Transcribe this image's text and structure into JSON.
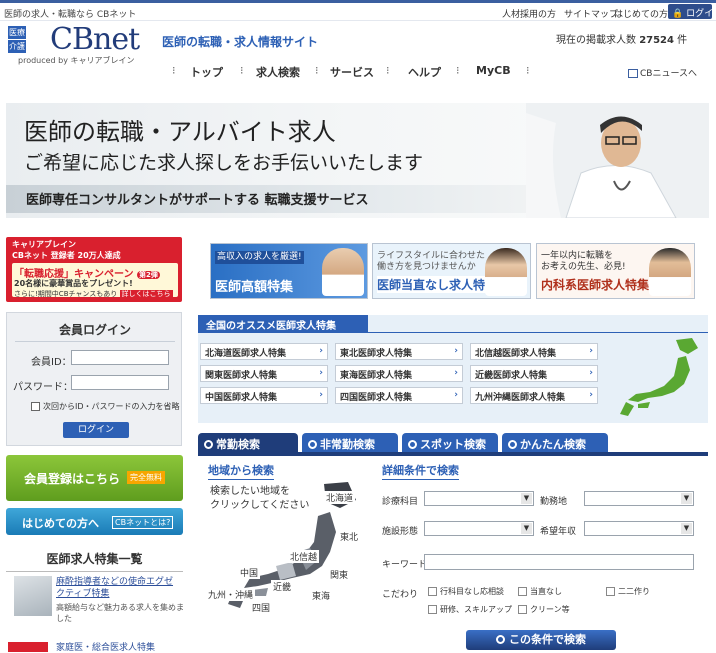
{
  "header": {
    "tagline": "医師の求人・転職なら CBネット",
    "top_links": [
      "人材採用の方",
      "サイトマップ",
      "はじめての方"
    ],
    "login_label": "ログイン",
    "logo_box_1": "医療",
    "logo_box_2": "介護",
    "logo_text": "CBnet",
    "logo_sub": "produced by キャリアブレイン",
    "site_subtitle": "医師の転職・求人情報サイト",
    "job_count_label": "現在の掲載求人数",
    "job_count_value": "27524",
    "job_count_unit": "件",
    "cbnews_label": "CBニュースへ"
  },
  "nav": {
    "items": [
      "トップ",
      "求人検索",
      "サービス",
      "ヘルプ",
      "MyCB"
    ]
  },
  "hero": {
    "line1": "医師の転職・アルバイト求人",
    "line2": "ご希望に応じた求人探しをお手伝いいたします",
    "line3": "医師専任コンサルタントがサポートする 転職支援サービス"
  },
  "promo": {
    "line1": "キャリアブレイン",
    "line2": "CBネット 登録者 20万人達成",
    "line3": "「転職応援」キャンペーン",
    "badge": "第2弾",
    "line4": "20名様に豪華賞品をプレゼント!",
    "line5": "さらに!期間中CBチャンスもあり",
    "link": "詳しくはこちら"
  },
  "login": {
    "title": "会員ログイン",
    "id_label": "会員ID：",
    "pw_label": "パスワード：",
    "remember_label": "次回からID・パスワードの入力を省略",
    "button": "ログイン"
  },
  "register": {
    "label": "会員登録はこちら",
    "badge": "完全無料"
  },
  "first_time": {
    "label": "はじめての方へ",
    "badge": "CBネットとは?"
  },
  "features": {
    "title": "医師求人特集一覧",
    "item1_link_l1": "麻酔指導者などの使命エグゼ",
    "item1_link_l2": "クティブ特集",
    "item1_desc_l1": "高額給与など魅力ある求人を集めま",
    "item1_desc_l2": "した",
    "item2_link": "家庭医・総合医求人特集"
  },
  "banners": [
    {
      "top": "高収入の求人を厳選!",
      "top2": "医師高額特集",
      "main": "医師高額特集"
    },
    {
      "top": "ライフスタイルに合わせた",
      "top2": "働き方を見つけませんか",
      "main": "医師当直なし求人特集"
    },
    {
      "top": "一年以内に転職を",
      "top2": "お考えの先生、必見!",
      "main": "内科系医師求人特集"
    }
  ],
  "osusume": {
    "title": "全国のオススメ医師求人特集",
    "rows": [
      [
        "北海道医師求人特集",
        "東北医師求人特集",
        "北信越医師求人特集"
      ],
      [
        "関東医師求人特集",
        "東海医師求人特集",
        "近畿医師求人特集"
      ],
      [
        "中国医師求人特集",
        "四国医師求人特集",
        "九州沖縄医師求人特集"
      ]
    ]
  },
  "search_tabs": [
    "常勤検索",
    "非常勤検索",
    "スポット検索",
    "かんたん検索"
  ],
  "area_search": {
    "title": "地域から検索",
    "desc_l1": "検索したい地域を",
    "desc_l2": "クリックしてください",
    "regions": [
      "北海道",
      "東北",
      "北信越",
      "関東",
      "東海",
      "近畿",
      "中国",
      "四国",
      "九州・沖縄"
    ]
  },
  "detail_search": {
    "title": "詳細条件で検索",
    "field_subject": "診療科目",
    "field_location": "勤務地",
    "field_facility": "施設形態",
    "field_salary": "希望年収",
    "field_keyword": "キーワード",
    "field_conditions": "こだわり",
    "checkboxes": [
      "行科目なし応相談",
      "当直なし",
      "二二作り",
      "研修、スキルアップ",
      "クリーン等"
    ],
    "button": "この条件で検索"
  },
  "colors": {
    "brand_blue": "#2d60b5",
    "navy": "#1f3d7a",
    "register_green": "#6aa825",
    "promo_red": "#d9202e"
  }
}
